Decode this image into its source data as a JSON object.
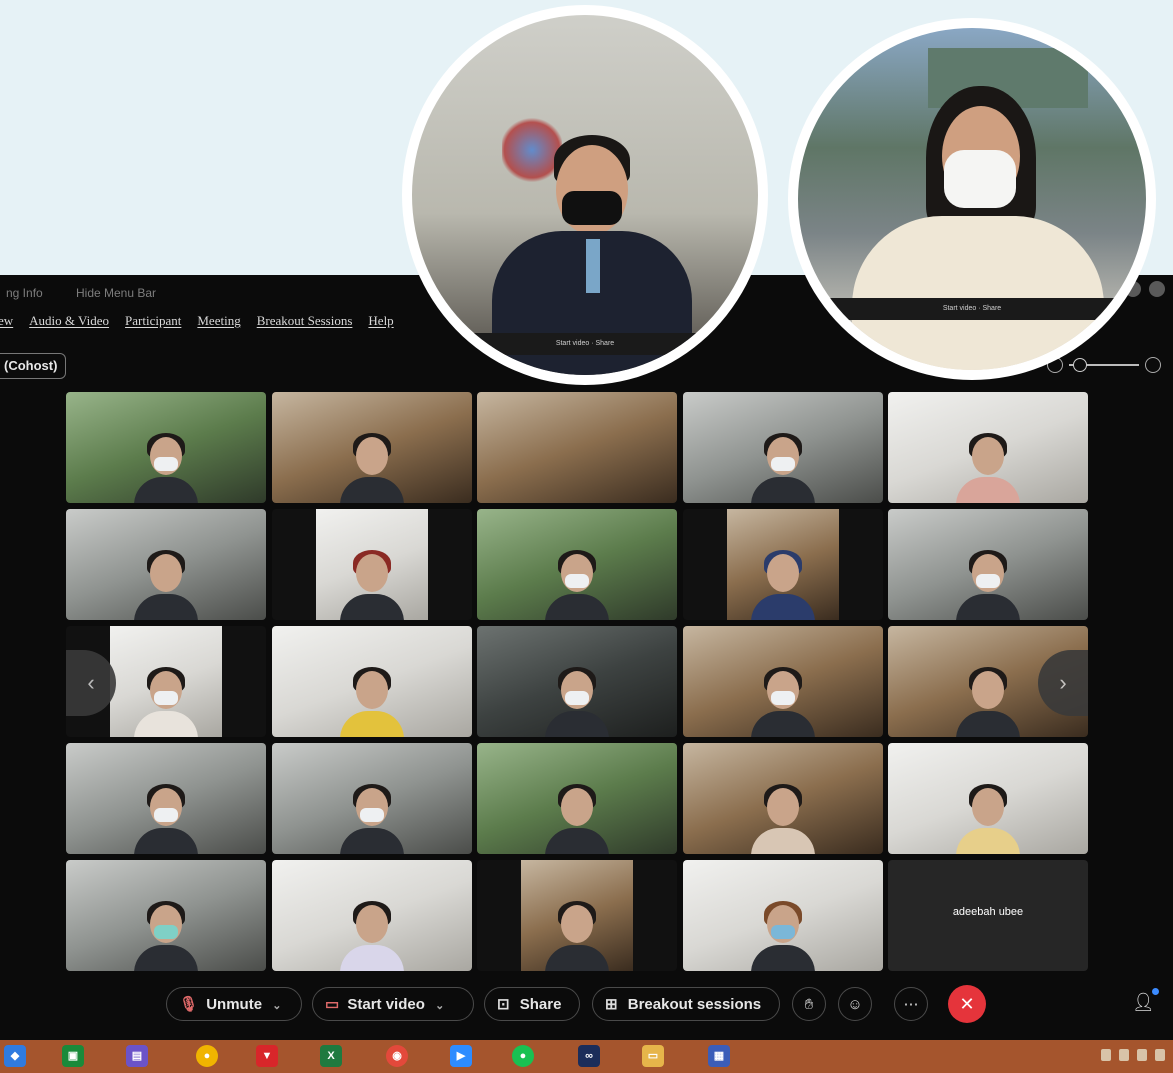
{
  "window": {
    "title_left": "ng Info",
    "title_hide": "Hide Menu Bar",
    "menu": [
      "ew",
      "Audio & Video",
      "Participant",
      "Meeting",
      "Breakout Sessions",
      "Help"
    ],
    "cohost_label": "(Cohost)"
  },
  "grid": {
    "name_only_tile": "adeebah ubee"
  },
  "toolbar": {
    "unmute": "Unmute",
    "start_video": "Start video",
    "share": "Share",
    "breakout": "Breakout sessions"
  },
  "inset": {
    "circle1_bar": "Start video · Share",
    "circle2_bar": "Start video · Share"
  },
  "colors": {
    "background": "#e6f2f6",
    "window": "#0b0b0b",
    "leave": "#e5343b",
    "taskbar": "#a5552d"
  }
}
